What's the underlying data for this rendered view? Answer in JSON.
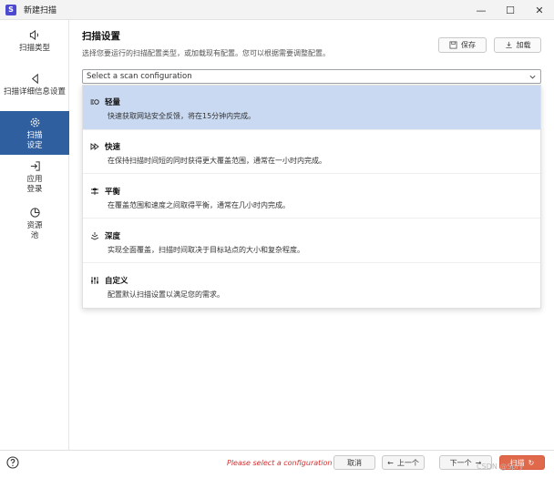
{
  "window": {
    "title": "新建扫描",
    "controls": [
      "—",
      "☐",
      "✕"
    ]
  },
  "sidebar": {
    "items": [
      {
        "label": "扫描类型",
        "icon": "speaker-icon"
      },
      {
        "label": "扫描详细信息设置",
        "icon": "play-back-icon"
      },
      {
        "label": "扫描设定",
        "label_lines": [
          "扫描",
          "设定"
        ],
        "icon": "gear-icon",
        "active": true
      },
      {
        "label": "应用登录",
        "label_lines": [
          "应用",
          "登录"
        ],
        "icon": "login-icon"
      },
      {
        "label": "资源池",
        "label_lines": [
          "资源",
          "池"
        ],
        "icon": "pie-chart-icon"
      }
    ]
  },
  "main": {
    "title": "扫描设置",
    "description": "选择您要运行的扫描配置类型，或加载现有配置。您可以根据需要调整配置。",
    "save_label": "保存",
    "load_label": "加载",
    "select_placeholder": "Select a scan configuration",
    "options": [
      {
        "title": "轻量",
        "desc": "快速获取网站安全反馈，将在15分钟内完成。",
        "icon": "light-scan-icon",
        "highlight": true
      },
      {
        "title": "快速",
        "desc": "在保持扫描时间短的同时获得更大覆盖范围，通常在一小时内完成。",
        "icon": "fast-forward-icon"
      },
      {
        "title": "平衡",
        "desc": "在覆盖范围和速度之间取得平衡，通常在几小时内完成。",
        "icon": "balance-icon"
      },
      {
        "title": "深度",
        "desc": "实现全面覆盖，扫描时间取决于目标站点的大小和复杂程度。",
        "icon": "deep-layers-icon"
      },
      {
        "title": "自定义",
        "desc": "配置默认扫描设置以满足您的需求。",
        "icon": "sliders-icon"
      }
    ]
  },
  "footer": {
    "error": "Please select a configuration",
    "cancel_label": "取消",
    "prev_label": "上一个",
    "next_label": "下一个",
    "scan_label": "扫描"
  },
  "watermark": "CSDN @Spry",
  "colors": {
    "accent": "#2f5f9e",
    "highlight": "#c9d9f1",
    "error": "#d23030",
    "primary": "#e0684b"
  }
}
